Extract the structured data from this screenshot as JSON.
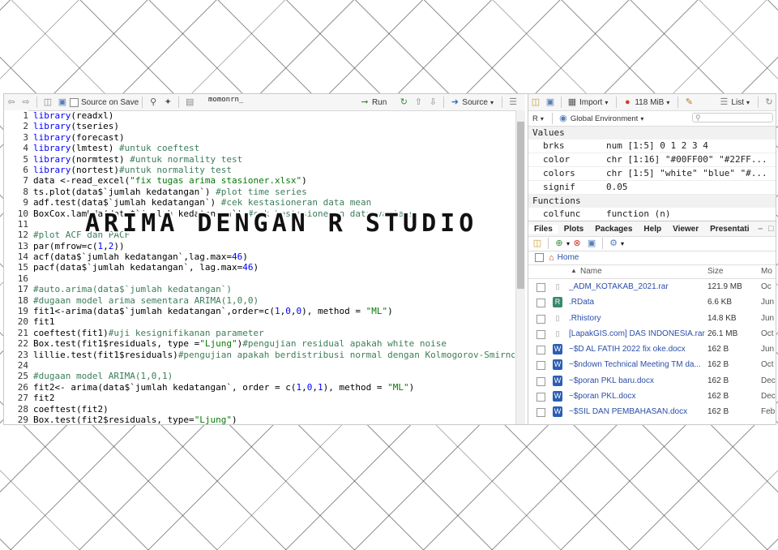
{
  "overlay_title": "ARIMA DENGAN R STUDIO",
  "editor": {
    "toolbar": {
      "source_on_save": "Source on Save",
      "tab_name": "momonrn_",
      "run": "Run",
      "source": "Source"
    },
    "line_numbers": [
      "1",
      "2",
      "3",
      "4",
      "5",
      "6",
      "7",
      "8",
      "9",
      "10",
      "11",
      "12",
      "13",
      "14",
      "15",
      "16",
      "17",
      "18",
      "19",
      "20",
      "21",
      "22",
      "23",
      "24",
      "25",
      "26",
      "27",
      "28",
      "29"
    ],
    "lines": [
      [
        {
          "t": "library",
          "c": "kw"
        },
        {
          "t": "(readxl)"
        }
      ],
      [
        {
          "t": "library",
          "c": "kw"
        },
        {
          "t": "(tseries)"
        }
      ],
      [
        {
          "t": "library",
          "c": "kw"
        },
        {
          "t": "(forecast)"
        }
      ],
      [
        {
          "t": "library",
          "c": "kw"
        },
        {
          "t": "(lmtest) "
        },
        {
          "t": "#untuk coeftest",
          "c": "cm"
        }
      ],
      [
        {
          "t": "library",
          "c": "kw"
        },
        {
          "t": "(normtest) "
        },
        {
          "t": "#untuk normality test",
          "c": "cm"
        }
      ],
      [
        {
          "t": "library",
          "c": "kw"
        },
        {
          "t": "(nortest)"
        },
        {
          "t": "#untuk normality test",
          "c": "cm"
        }
      ],
      [
        {
          "t": "data <-read_excel("
        },
        {
          "t": "\"fix tugas arima stasioner.xlsx\"",
          "c": "st"
        },
        {
          "t": ")"
        }
      ],
      [
        {
          "t": "ts.plot(data$`jumlah kedatangan`) "
        },
        {
          "t": "#plot time series",
          "c": "cm"
        }
      ],
      [
        {
          "t": "adf.test(data$`jumlah kedatangan`) "
        },
        {
          "t": "#cek kestasioneran data mean",
          "c": "cm"
        }
      ],
      [
        {
          "t": "BoxCox.lambda(data$`jumlah kedatangan`) "
        },
        {
          "t": "#cek kestasioneran data varians",
          "c": "cm"
        }
      ],
      [
        {
          "t": ""
        }
      ],
      [
        {
          "t": "#plot ACF dan PACF",
          "c": "cm"
        }
      ],
      [
        {
          "t": "par(mfrow=c("
        },
        {
          "t": "1",
          "c": "nm"
        },
        {
          "t": ","
        },
        {
          "t": "2",
          "c": "nm"
        },
        {
          "t": "))"
        }
      ],
      [
        {
          "t": "acf(data$`jumlah kedatangan`,lag.max="
        },
        {
          "t": "46",
          "c": "nm"
        },
        {
          "t": ")"
        }
      ],
      [
        {
          "t": "pacf(data$`jumlah kedatangan`, lag.max="
        },
        {
          "t": "46",
          "c": "nm"
        },
        {
          "t": ")"
        }
      ],
      [
        {
          "t": ""
        }
      ],
      [
        {
          "t": "#auto.arima(data$`jumlah kedatangan`)",
          "c": "cm"
        }
      ],
      [
        {
          "t": "#dugaan model arima sementara ARIMA(1,0,0)",
          "c": "cm"
        }
      ],
      [
        {
          "t": "fit1<-arima(data$`jumlah kedatangan`,order=c("
        },
        {
          "t": "1",
          "c": "nm"
        },
        {
          "t": ","
        },
        {
          "t": "0",
          "c": "nm"
        },
        {
          "t": ","
        },
        {
          "t": "0",
          "c": "nm"
        },
        {
          "t": "), method = "
        },
        {
          "t": "\"ML\"",
          "c": "st"
        },
        {
          "t": ")"
        }
      ],
      [
        {
          "t": "fit1"
        }
      ],
      [
        {
          "t": "coeftest(fit1)"
        },
        {
          "t": "#uji kesignifikanan parameter",
          "c": "cm"
        }
      ],
      [
        {
          "t": "Box.test(fit1$residuals, type ="
        },
        {
          "t": "\"Ljung\"",
          "c": "st"
        },
        {
          "t": ")"
        },
        {
          "t": "#pengujian residual apakah white noise",
          "c": "cm"
        }
      ],
      [
        {
          "t": "lillie.test(fit1$residuals)"
        },
        {
          "t": "#pengujian apakah berdistribusi normal dengan Kolmogorov-Smirnov",
          "c": "cm"
        }
      ],
      [
        {
          "t": ""
        }
      ],
      [
        {
          "t": "#dugaan model ARIMA(1,0,1)",
          "c": "cm"
        }
      ],
      [
        {
          "t": "fit2<- arima(data$`jumlah kedatangan`, order = c("
        },
        {
          "t": "1",
          "c": "nm"
        },
        {
          "t": ","
        },
        {
          "t": "0",
          "c": "nm"
        },
        {
          "t": ","
        },
        {
          "t": "1",
          "c": "nm"
        },
        {
          "t": "), method = "
        },
        {
          "t": "\"ML\"",
          "c": "st"
        },
        {
          "t": ")"
        }
      ],
      [
        {
          "t": "fit2"
        }
      ],
      [
        {
          "t": "coeftest(fit2)"
        }
      ],
      [
        {
          "t": "Box.test(fit2$residuals, type="
        },
        {
          "t": "\"Ljung\"",
          "c": "st"
        },
        {
          "t": ")"
        }
      ]
    ]
  },
  "environment": {
    "toolbar": {
      "import": "Import",
      "memory": "118 MiB",
      "list": "List"
    },
    "lang": "R",
    "scope": "Global Environment",
    "values_header": "Values",
    "values": [
      {
        "name": "brks",
        "value": "num [1:5] 0 1 2 3 4"
      },
      {
        "name": "color",
        "value": "chr [1:16] \"#00FF00\" \"#22FF..."
      },
      {
        "name": "colors",
        "value": "chr [1:5] \"white\" \"blue\" \"#..."
      },
      {
        "name": "signif",
        "value": "0.05"
      }
    ],
    "functions_header": "Functions",
    "functions": [
      {
        "name": "colfunc",
        "value": "function (n)"
      }
    ]
  },
  "files": {
    "tabs": [
      "Files",
      "Plots",
      "Packages",
      "Help",
      "Viewer",
      "Presentati"
    ],
    "path": "Home",
    "col_name": "Name",
    "col_size": "Size",
    "col_modified": "Mo",
    "rows": [
      {
        "icon": "doc",
        "name": "_ADM_KOTAKAB_2021.rar",
        "size": "121.9 MB",
        "mod": "Oc"
      },
      {
        "icon": "rdata",
        "name": ".RData",
        "size": "6.6 KB",
        "mod": "Jun"
      },
      {
        "icon": "doc",
        "name": ".Rhistory",
        "size": "14.8 KB",
        "mod": "Jun"
      },
      {
        "icon": "doc",
        "name": "[LapakGIS.com] DAS INDONESIA.rar",
        "size": "26.1 MB",
        "mod": "Oct"
      },
      {
        "icon": "word",
        "name": "~$D AL FATIH 2022 fix oke.docx",
        "size": "162 B",
        "mod": "Jun"
      },
      {
        "icon": "word",
        "name": "~$ndown Technical Meeting TM da...",
        "size": "162 B",
        "mod": "Oct"
      },
      {
        "icon": "word",
        "name": "~$poran PKL baru.docx",
        "size": "162 B",
        "mod": "Dec"
      },
      {
        "icon": "word",
        "name": "~$poran PKL.docx",
        "size": "162 B",
        "mod": "Dec"
      },
      {
        "icon": "word",
        "name": "~$SIL DAN PEMBAHASAN.docx",
        "size": "162 B",
        "mod": "Feb"
      }
    ]
  }
}
